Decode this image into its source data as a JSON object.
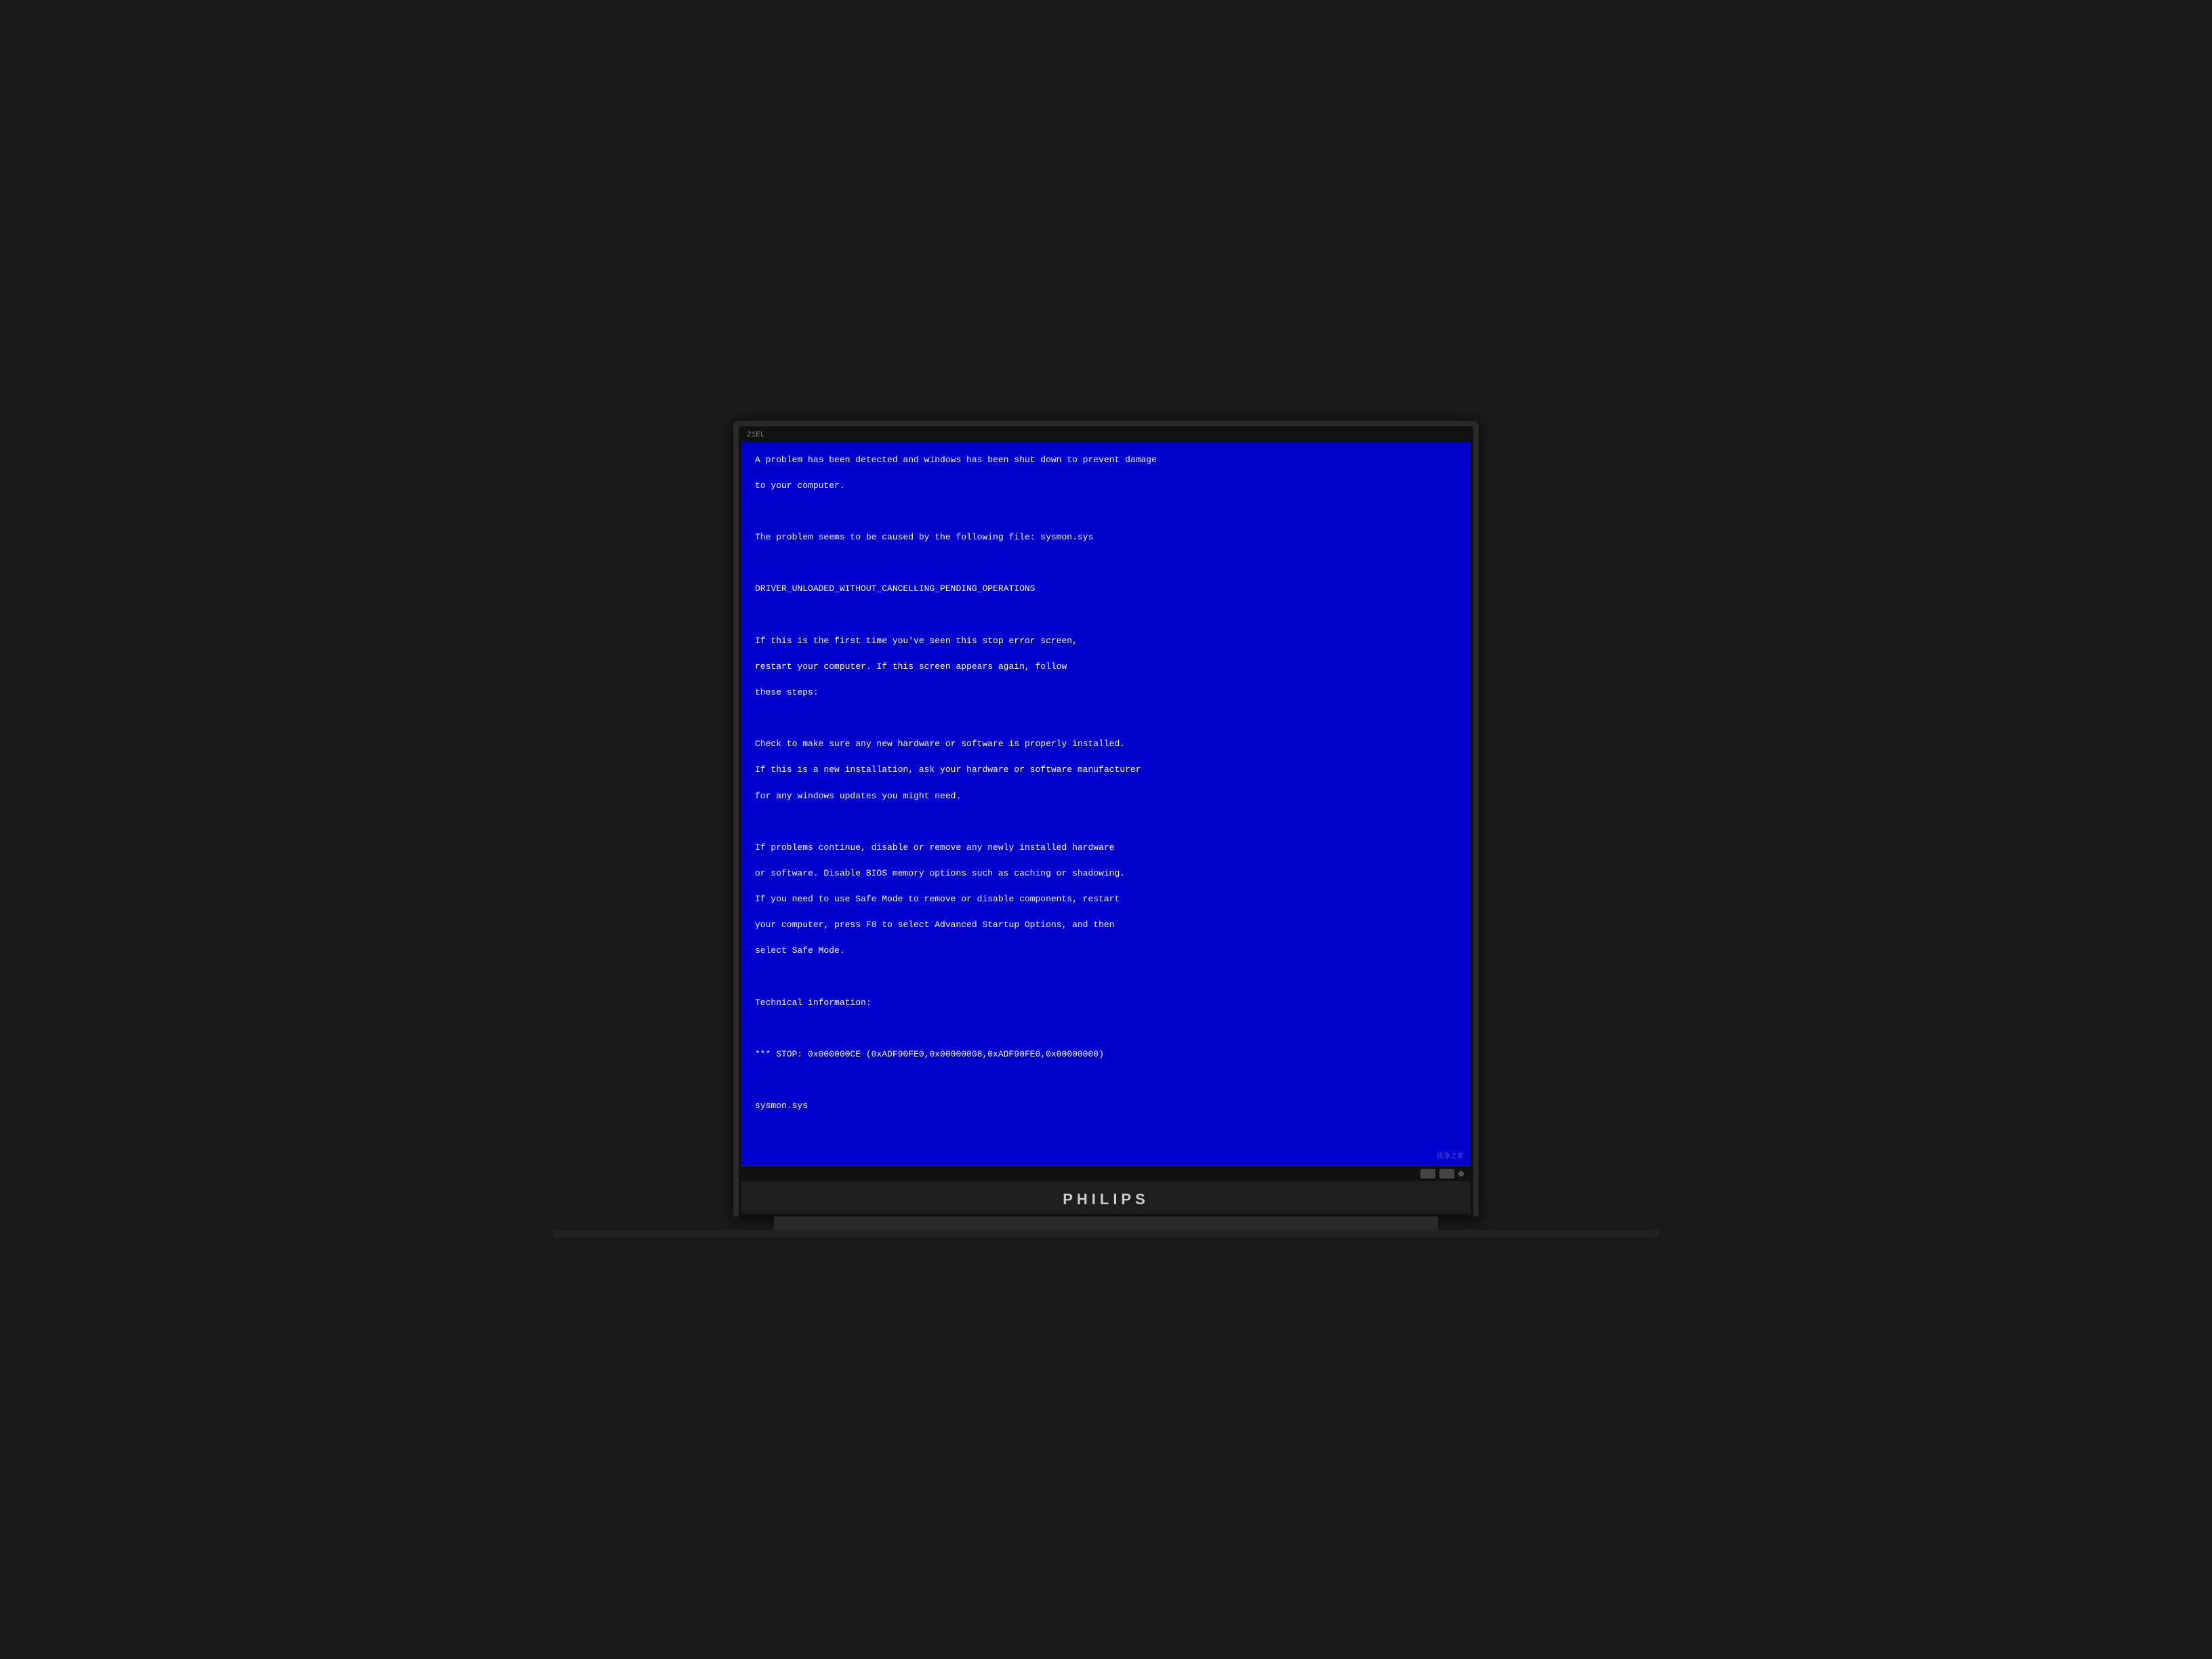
{
  "monitor": {
    "brand": "PHILIPS",
    "title_bar": "21EL"
  },
  "bsod": {
    "lines": [
      {
        "id": "line1",
        "text": "A problem has been detected and windows has been shut down to prevent damage"
      },
      {
        "id": "line2",
        "text": "to your computer."
      },
      {
        "id": "line3",
        "text": ""
      },
      {
        "id": "line4",
        "text": "The problem seems to be caused by the following file: sysmon.sys"
      },
      {
        "id": "line5",
        "text": ""
      },
      {
        "id": "line6",
        "text": "DRIVER_UNLOADED_WITHOUT_CANCELLING_PENDING_OPERATIONS"
      },
      {
        "id": "line7",
        "text": ""
      },
      {
        "id": "line8",
        "text": "If this is the first time you've seen this stop error screen,"
      },
      {
        "id": "line9",
        "text": "restart your computer. If this screen appears again, follow"
      },
      {
        "id": "line10",
        "text": "these steps:"
      },
      {
        "id": "line11",
        "text": ""
      },
      {
        "id": "line12",
        "text": "Check to make sure any new hardware or software is properly installed."
      },
      {
        "id": "line13",
        "text": "If this is a new installation, ask your hardware or software manufacturer"
      },
      {
        "id": "line14",
        "text": "for any windows updates you might need."
      },
      {
        "id": "line15",
        "text": ""
      },
      {
        "id": "line16",
        "text": "If problems continue, disable or remove any newly installed hardware"
      },
      {
        "id": "line17",
        "text": "or software. Disable BIOS memory options such as caching or shadowing."
      },
      {
        "id": "line18",
        "text": "If you need to use Safe Mode to remove or disable components, restart"
      },
      {
        "id": "line19",
        "text": "your computer, press F8 to select Advanced Startup Options, and then"
      },
      {
        "id": "line20",
        "text": "select Safe Mode."
      },
      {
        "id": "line21",
        "text": ""
      },
      {
        "id": "line22",
        "text": "Technical information:"
      },
      {
        "id": "line23",
        "text": ""
      },
      {
        "id": "line24",
        "text": "*** STOP: 0x000000CE (0xADF90FE0,0x00000008,0xADF90FE0,0x00000000)"
      },
      {
        "id": "line25",
        "text": ""
      },
      {
        "id": "line26",
        "text": "sysmon.sys"
      }
    ]
  }
}
